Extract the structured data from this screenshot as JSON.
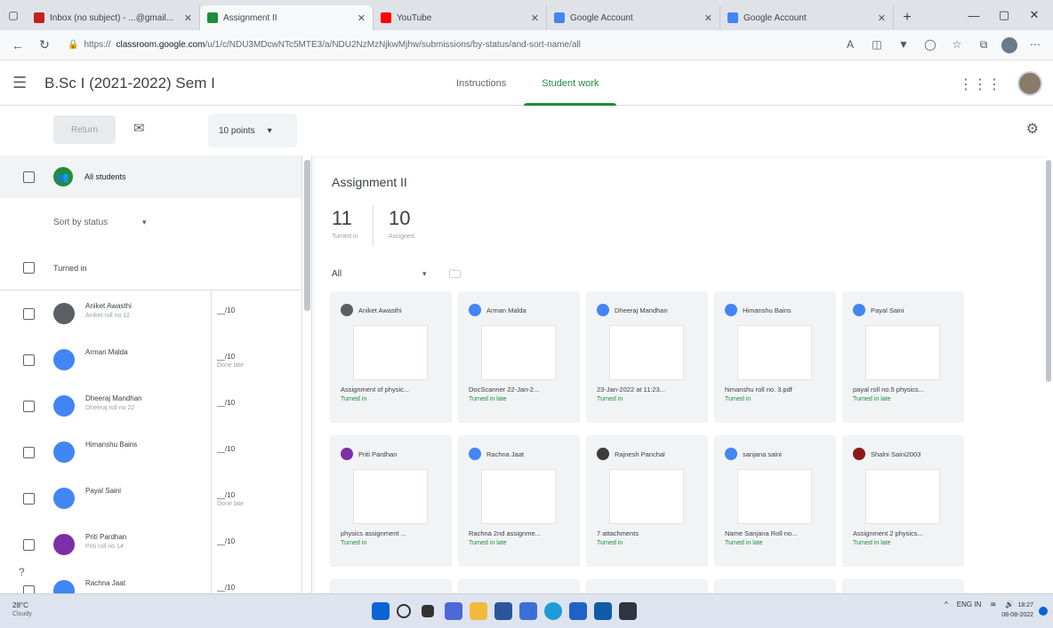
{
  "browser": {
    "tabs": [
      {
        "title": "Inbox (no subject) - ...@gmail...",
        "color": "#c5221f"
      },
      {
        "title": "Assignment II",
        "color": "#1e8e3e",
        "active": true
      },
      {
        "title": "YouTube",
        "color": "#ff0000"
      },
      {
        "title": "Google Account",
        "color": "#4285f4"
      },
      {
        "title": "Google Account",
        "color": "#4285f4"
      }
    ],
    "new_tab": "+",
    "url_prefix": "https://",
    "url_host": "classroom.google.com",
    "url_path": "/u/1/c/NDU3MDcwNTc5MTE3/a/NDU2NzMzNjkwMjhw/submissions/by-status/and-sort-name/all"
  },
  "header": {
    "class_title": "B.Sc I (2021-2022) Sem I",
    "tabs": [
      {
        "label": "Instructions",
        "active": false
      },
      {
        "label": "Student work",
        "active": true
      }
    ]
  },
  "toolbar": {
    "return_label": "Return",
    "points_label": "10 points"
  },
  "left": {
    "all_students": "All students",
    "sort_label": "Sort by status",
    "turned_in_label": "Turned in",
    "students": [
      {
        "name": "Aniket Awasthi",
        "note": "Aniket roll no 12",
        "grade": "__/10",
        "grade_note": "",
        "avatar": "#5b5f63"
      },
      {
        "name": "Arman Malda",
        "note": "",
        "grade": "__/10",
        "grade_note": "Done late",
        "avatar": "#4285f4"
      },
      {
        "name": "Dheeraj Mandhan",
        "note": "Dheeraj roll no 22",
        "grade": "__/10",
        "grade_note": "",
        "avatar": "#4285f4"
      },
      {
        "name": "Himanshu Bains",
        "note": "",
        "grade": "__/10",
        "grade_note": "",
        "avatar": "#4285f4"
      },
      {
        "name": "Payal Saini",
        "note": "",
        "grade": "__/10",
        "grade_note": "Done late",
        "avatar": "#4285f4"
      },
      {
        "name": "Priti Pardhan",
        "note": "Priti roll no 14",
        "grade": "__/10",
        "grade_note": "",
        "avatar": "#7b2fa8"
      },
      {
        "name": "Rachna Jaat",
        "note": "",
        "grade": "__/10",
        "grade_note": "",
        "avatar": "#4285f4"
      }
    ]
  },
  "main": {
    "assignment_title": "Assignment II",
    "turned_in_count": "11",
    "turned_in_label": "Turned in",
    "assigned_count": "10",
    "assigned_label": "Assigned",
    "filter": "All",
    "cards": [
      {
        "name": "Aniket Awasthi",
        "file": "Assignment of physic...",
        "status": "Turned in",
        "avatar": "#5b5f63"
      },
      {
        "name": "Arman Malda",
        "file": "DocScanner 22-Jan-2...",
        "status": "Turned in late",
        "avatar": "#4285f4"
      },
      {
        "name": "Dheeraj Mandhan",
        "file": "23-Jan-2022 at 11:23...",
        "status": "Turned in",
        "avatar": "#4285f4"
      },
      {
        "name": "Himanshu Bains",
        "file": "himanshu roll no. 3.pdf",
        "status": "Turned in",
        "avatar": "#4285f4"
      },
      {
        "name": "Payal Saini",
        "file": "payal roll no.5 physics...",
        "status": "Turned in late",
        "avatar": "#4285f4"
      },
      {
        "name": "Priti Pardhan",
        "file": "physics assignment ...",
        "status": "Turned in",
        "avatar": "#7b2fa8"
      },
      {
        "name": "Rachna Jaat",
        "file": "Rachna 2nd assignme...",
        "status": "Turned in late",
        "avatar": "#4285f4"
      },
      {
        "name": "Rajnesh Panchal",
        "file": "7 attachments",
        "status": "Turned in",
        "avatar": "#3c3c3c"
      },
      {
        "name": "sanjana saini",
        "file": "Name Sanjana Roll no...",
        "status": "Turned in late",
        "avatar": "#4285f4"
      },
      {
        "name": "Shalni Saini2003",
        "file": "Assignment 2 physics...",
        "status": "Turned in late",
        "avatar": "#8b1a1a"
      }
    ]
  },
  "taskbar": {
    "temp": "28°C",
    "weather": "Cloudy",
    "lang": "ENG IN",
    "time": "18:27",
    "date": "08-08-2022"
  },
  "colors": {
    "accent": "#1e8e3e",
    "blue": "#4285f4"
  }
}
